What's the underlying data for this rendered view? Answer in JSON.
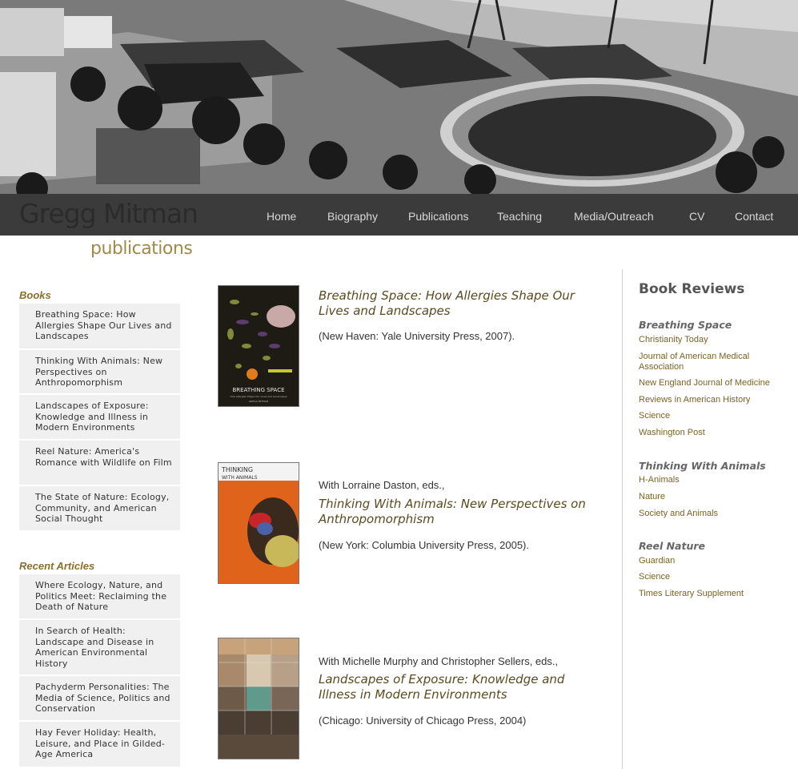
{
  "header": {
    "site_title": "Gregg Mitman",
    "section_title": "publications"
  },
  "nav": {
    "items": [
      {
        "label": "Home"
      },
      {
        "label": "Biography"
      },
      {
        "label": "Publications"
      },
      {
        "label": "Teaching"
      },
      {
        "label": "Media/Outreach"
      },
      {
        "label": "CV"
      },
      {
        "label": "Contact"
      }
    ]
  },
  "sidebar": {
    "books_heading": "Books",
    "books": [
      "Breathing Space: How Allergies Shape Our Lives and Landscapes",
      "Thinking With Animals: New Perspectives on Anthropomorphism",
      "Landscapes of Exposure: Knowledge and Illness in Modern Environments",
      "Reel Nature: America's Romance with Wildlife on Film",
      "The State of Nature: Ecology, Community, and American Social Thought"
    ],
    "articles_heading": "Recent Articles",
    "articles": [
      "Where Ecology, Nature, and Politics Meet: Reclaiming the Death of Nature",
      "In Search of Health: Landscape and Disease in American Environmental History",
      "Pachyderm Personalities: The Media of Science, Politics and Conservation",
      "Hay Fever Holiday: Health, Leisure, and Place in Gilded-Age America"
    ]
  },
  "publications": [
    {
      "coeditors": "",
      "title": "Breathing Space: How Allergies Shape Our Lives and Landscapes",
      "publisher": "(New Haven: Yale University Press, 2007).",
      "cover": {
        "title": "BREATHING SPACE",
        "subtitle": "How Allergies Shape Our Lives and Landscapes",
        "author": "GREGG MITMAN"
      }
    },
    {
      "coeditors": "With Lorraine Daston, eds.,",
      "title": "Thinking With Animals: New Perspectives on Anthropomorphism",
      "publisher": "(New York: Columbia University Press, 2005).",
      "cover": {
        "title": "THINKING",
        "title2": "WITH ANIMALS"
      }
    },
    {
      "coeditors": "With Michelle Murphy and Christopher Sellers, eds.,",
      "title": "Landscapes of Exposure: Knowledge and Illness in Modern Environments",
      "publisher": "(Chicago: University of Chicago Press, 2004)"
    }
  ],
  "reviews": {
    "title": "Book Reviews",
    "groups": [
      {
        "title": "Breathing Space",
        "links": [
          "Christianity Today",
          "Journal of American Medical Association",
          "New England Journal of Medicine",
          "Reviews in American History",
          "Science",
          "Washington Post"
        ]
      },
      {
        "title": "Thinking With Animals",
        "links": [
          "H-Animals",
          "Nature",
          "Society and Animals"
        ]
      },
      {
        "title": "Reel Nature",
        "links": [
          "Guardian",
          "Science",
          "Times Literary Supplement"
        ]
      }
    ]
  },
  "colors": {
    "nav_bg": "#3b3b3b",
    "accent": "#a08a4a",
    "link": "#7a6324",
    "sidebar_item_bg": "#f0f0f0"
  }
}
